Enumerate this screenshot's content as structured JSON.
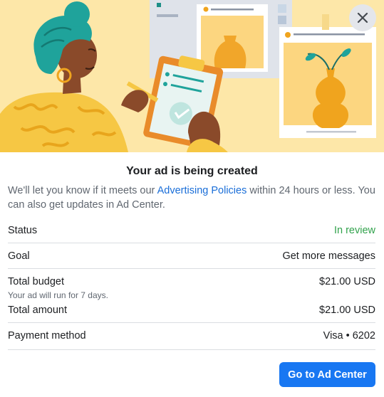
{
  "dialog": {
    "close_icon": "close-icon",
    "title": "Your ad is being created",
    "description": {
      "before_link": "We'll let you know if it meets our ",
      "link": "Advertising Policies",
      "after_link": " within 24 hours or less. You can also get updates in Ad Center."
    },
    "rows": {
      "status": {
        "label": "Status",
        "value": "In review"
      },
      "goal": {
        "label": "Goal",
        "value": "Get more messages"
      },
      "budget": {
        "label": "Total budget",
        "value": "$21.00 USD",
        "note": "Your ad will run for 7 days."
      },
      "amount": {
        "label": "Total amount",
        "value": "$21.00 USD"
      },
      "payment": {
        "label": "Payment method",
        "value": "Visa • 6202"
      }
    },
    "cta_label": "Go to Ad Center"
  },
  "colors": {
    "accent": "#1877f2",
    "link": "#1a6ed8",
    "status_green": "#31a24c",
    "hero_bg": "#fde7a8"
  }
}
